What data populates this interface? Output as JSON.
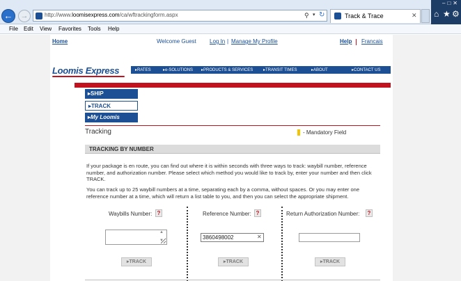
{
  "browser": {
    "url_prefix": "http://www.",
    "url_domain": "loomisexpress.com",
    "url_path": "/ca/wftrackingform.aspx",
    "tab_title": "Track & Trace",
    "menu": [
      "File",
      "Edit",
      "View",
      "Favorites",
      "Tools",
      "Help"
    ]
  },
  "toplinks": {
    "home": "Home",
    "welcome": "Welcome Guest",
    "login": "Log In",
    "separator": "|",
    "manage": "Manage My Profile",
    "help": "Help",
    "francais": "Francais"
  },
  "logo": {
    "text": "Loomis Express"
  },
  "nav": [
    "RATES",
    "e-SOLUTIONS",
    "PRODUCTS & SERVICES",
    "TRANSIT TIMES",
    "ABOUT",
    "CONTACT US"
  ],
  "sidebar": {
    "ship": "SHIP",
    "track": "TRACK",
    "myloomis": "My Loomis"
  },
  "page": {
    "title": "Tracking",
    "mandatory": "- Mandatory Field",
    "section_header": "TRACKING BY NUMBER",
    "para1": "If your package is en route, you can find out where it is within seconds with three ways to track: waybill number, reference number, and authorization number. Please select which method you would like to track by, enter your number and then click TRACK.",
    "para2": "You can track up to 25 waybill numbers at a time, separating each by a comma, without spaces. Or you may enter one reference number at a time, which will return a list table to you, and then you can select the appropriate shipment."
  },
  "form": {
    "waybill_label": "Waybills Number:",
    "reference_label": "Reference Number:",
    "ra_label": "Return Authorization Number:",
    "help_glyph": "?",
    "reference_value": "3860498002",
    "track_label": "TRACK"
  },
  "colors": {
    "brand_blue": "#1c4f93",
    "brand_red": "#c1121f",
    "mandatory": "#f5c400"
  }
}
